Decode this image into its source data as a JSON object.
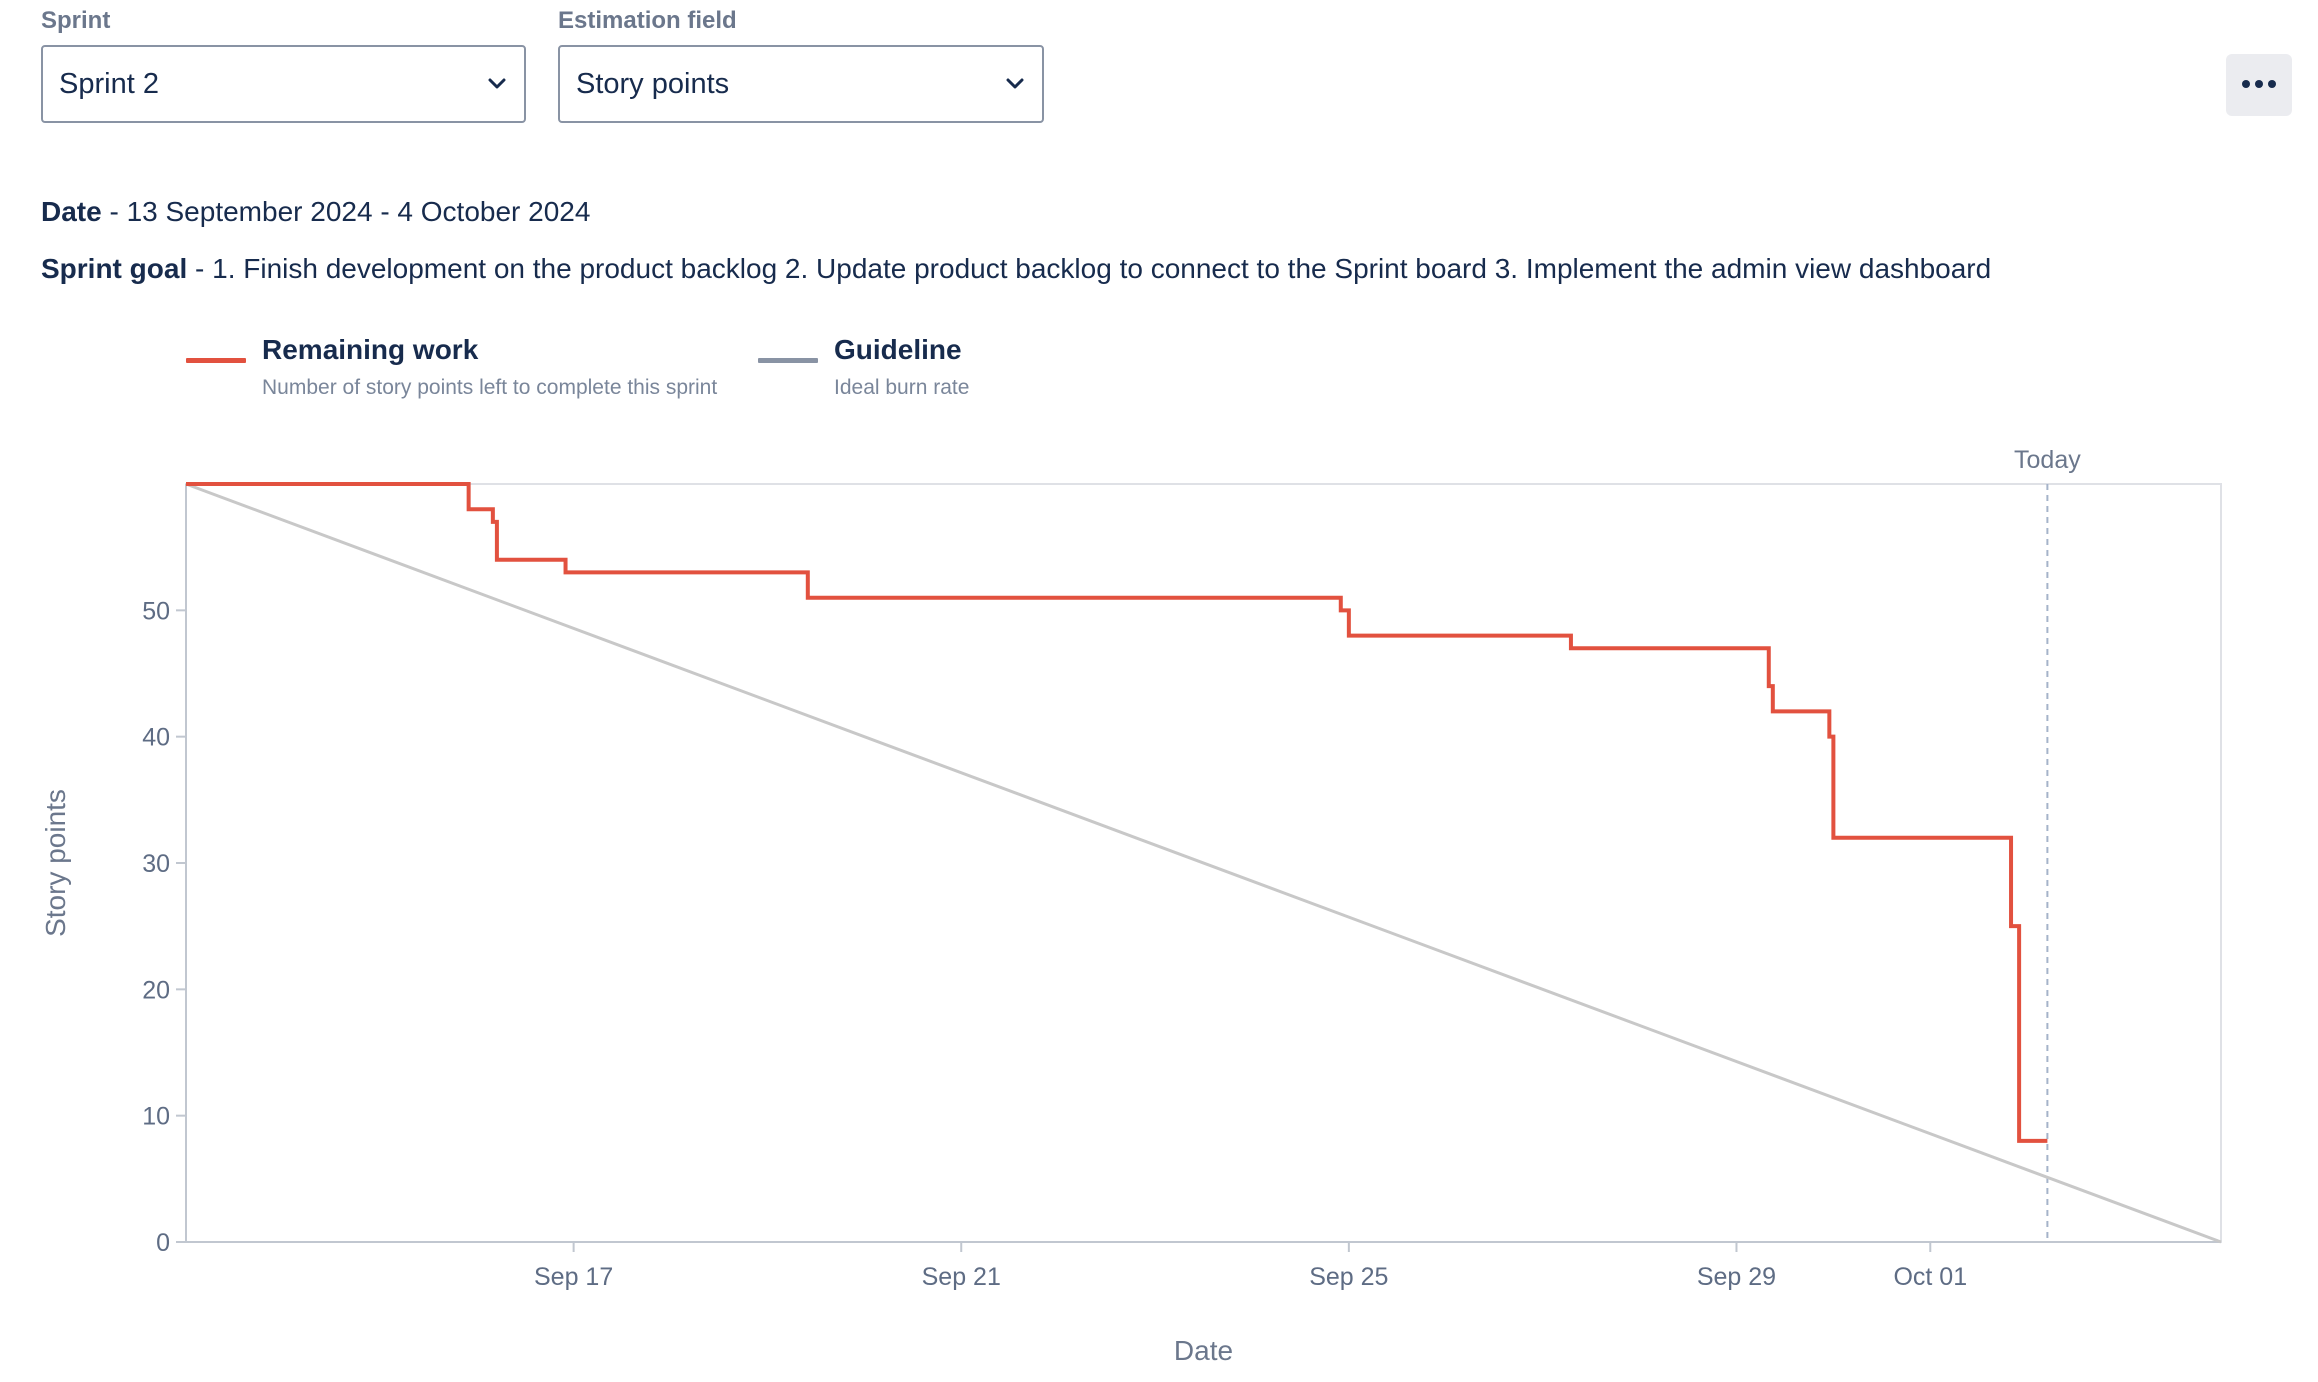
{
  "filters": {
    "sprint_label": "Sprint",
    "sprint_value": "Sprint 2",
    "estimation_label": "Estimation field",
    "estimation_value": "Story points"
  },
  "info": {
    "date_label": "Date",
    "date_value": " - 13 September 2024 - 4 October 2024",
    "goal_label": "Sprint goal",
    "goal_value": " - 1. Finish development on the product backlog 2. Update product backlog to connect to the Sprint board 3. Implement the admin view dashboard"
  },
  "legend": {
    "remaining_title": "Remaining work",
    "remaining_sub": "Number of story points left to complete this sprint",
    "guideline_title": "Guideline",
    "guideline_sub": "Ideal burn rate"
  },
  "colors": {
    "remaining": "#e2513f",
    "guideline": "#c8c8c8",
    "legend_guideline": "#8993a4",
    "today_line": "#a5b3c9"
  },
  "icons": {
    "more": "more-horizontal-icon",
    "chevron": "chevron-down-icon"
  },
  "chart_data": {
    "type": "line",
    "title": "",
    "xlabel": "Date",
    "ylabel": "Story points",
    "today_label": "Today",
    "x_domain": [
      "2024-09-13",
      "2024-10-04"
    ],
    "ylim": [
      0,
      60
    ],
    "y_ticks": [
      0,
      10,
      20,
      30,
      40,
      50
    ],
    "x_ticks": [
      {
        "date": "2024-09-17",
        "label": "Sep 17"
      },
      {
        "date": "2024-09-21",
        "label": "Sep 21"
      },
      {
        "date": "2024-09-25",
        "label": "Sep 25"
      },
      {
        "date": "2024-09-29",
        "label": "Sep 29"
      },
      {
        "date": "2024-10-01",
        "label": "Oct 01"
      }
    ],
    "today": "2024-10-02T05:00",
    "grid": false,
    "series": [
      {
        "name": "Remaining work",
        "step": true,
        "points": [
          [
            "2024-09-13T00:00",
            60
          ],
          [
            "2024-09-15T22:00",
            58
          ],
          [
            "2024-09-16T04:00",
            57
          ],
          [
            "2024-09-16T05:00",
            54
          ],
          [
            "2024-09-16T22:00",
            53
          ],
          [
            "2024-09-19T10:00",
            51
          ],
          [
            "2024-09-24T22:00",
            50
          ],
          [
            "2024-09-25T00:00",
            48
          ],
          [
            "2024-09-27T07:00",
            47
          ],
          [
            "2024-09-29T08:00",
            44
          ],
          [
            "2024-09-29T09:00",
            42
          ],
          [
            "2024-09-29T23:00",
            40
          ],
          [
            "2024-09-30T00:00",
            32
          ],
          [
            "2024-10-01T20:00",
            25
          ],
          [
            "2024-10-01T22:00",
            8
          ],
          [
            "2024-10-02T05:00",
            8
          ]
        ]
      },
      {
        "name": "Guideline",
        "step": false,
        "points": [
          [
            "2024-09-13T00:00",
            60
          ],
          [
            "2024-10-04T00:00",
            0
          ]
        ]
      }
    ]
  }
}
